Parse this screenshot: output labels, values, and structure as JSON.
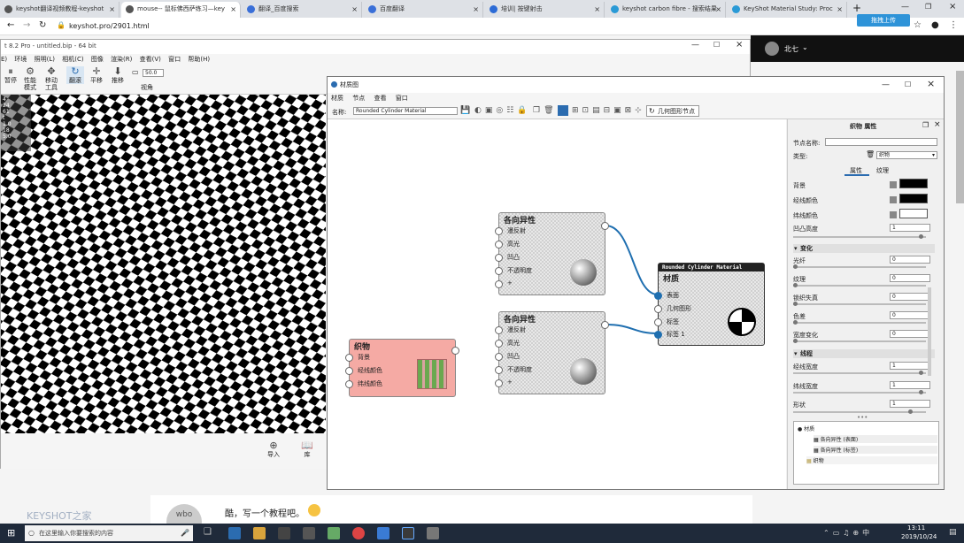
{
  "browser": {
    "tabs": [
      {
        "label": "keyshot翻译视频教程-keyshot"
      },
      {
        "label": "mouse-- 鼠标佛西萨练习—key"
      },
      {
        "label": "翻译_百度搜索"
      },
      {
        "label": "百度翻译"
      },
      {
        "label": "培训| 按键射击"
      },
      {
        "label": "keyshot carbon fibre - 搜索结果"
      },
      {
        "label": "KeyShot Material Study: Proc"
      }
    ],
    "new_tab": "+",
    "url": "keyshot.pro/2901.html",
    "upload_badge": "拖拽上传",
    "user_name": "北七"
  },
  "keyshot": {
    "title": "t 8.2 Pro - untitled.bip - 64 bit",
    "menu": [
      "E)",
      "环境",
      "照明(L)",
      "相机(C)",
      "图像",
      "渲染(R)",
      "查看(V)",
      "窗口",
      "帮助(H)"
    ],
    "toolbar": [
      {
        "label": "暂停",
        "icon": "pause-icon"
      },
      {
        "label": "性能\n模式",
        "icon": "performance-icon"
      },
      {
        "label": "移动\n工具",
        "icon": "move-tool-icon"
      },
      {
        "label": "翻滚",
        "icon": "tumble-icon"
      },
      {
        "label": "平移",
        "icon": "pan-icon"
      },
      {
        "label": "推移",
        "icon": "dolly-icon"
      }
    ],
    "fov_value": "50.0",
    "fov_label": "视角",
    "overlay_stats": [
      "4",
      "24",
      "61",
      "t",
      "1.0",
      "18",
      "5.0"
    ],
    "bottom": [
      {
        "label": "导入",
        "icon": "import-icon"
      },
      {
        "label": "库",
        "icon": "library-icon"
      }
    ]
  },
  "material_graph": {
    "title": "材质图",
    "menu": [
      "材质",
      "节点",
      "查看",
      "窗口"
    ],
    "name_label": "名称:",
    "name_value": "Rounded Cylinder Material",
    "geometry_btn": "几何图形节点",
    "nodes": {
      "aniso1": {
        "title": "各向异性",
        "ports": [
          "漫反射",
          "高光",
          "凹凸",
          "不透明度",
          "+"
        ]
      },
      "aniso2": {
        "title": "各向异性",
        "ports": [
          "漫反射",
          "高光",
          "凹凸",
          "不透明度",
          "+"
        ]
      },
      "weave": {
        "title": "织物",
        "ports": [
          "背景",
          "经线颜色",
          "纬线颜色"
        ]
      },
      "material": {
        "header": "Rounded Cylinder Material",
        "title": "材质",
        "ports": [
          "表面",
          "几何图形",
          "标签",
          "标签 1"
        ]
      }
    }
  },
  "panel": {
    "title": "织物 属性",
    "node_name_label": "节点名称:",
    "node_name_value": "",
    "type_label": "类型:",
    "type_value": "织物",
    "tabs": [
      "属性",
      "纹理"
    ],
    "props": [
      {
        "label": "背景",
        "color": "#000000"
      },
      {
        "label": "经线颜色",
        "color": "#000000"
      },
      {
        "label": "纬线颜色",
        "color": "#ffffff"
      }
    ],
    "bump_label": "凹凸高度",
    "bump_value": "1",
    "variation_header": "变化",
    "variation": [
      {
        "label": "光纤",
        "value": "0"
      },
      {
        "label": "纹理",
        "value": "0"
      },
      {
        "label": "锁织失真",
        "value": "0"
      },
      {
        "label": "色差",
        "value": "0"
      },
      {
        "label": "宽度变化",
        "value": "0"
      }
    ],
    "thread_header": "线程",
    "thread": [
      {
        "label": "经线宽度",
        "value": "1"
      },
      {
        "label": "纬线宽度",
        "value": "1"
      },
      {
        "label": "形状",
        "value": "1"
      }
    ],
    "tree": [
      {
        "label": "材质",
        "level": 0
      },
      {
        "label": "各向异性 (表面)",
        "level": 1
      },
      {
        "label": "各向异性 (标签)",
        "level": 1
      },
      {
        "label": "织物",
        "level": 1
      }
    ]
  },
  "comment": {
    "avatar_text": "wbo",
    "text": "酷，写一个教程吧。",
    "username": "KEYSHOT之家"
  },
  "taskbar": {
    "search_placeholder": "在这里输入你要搜索的内容",
    "time": "13:11",
    "date": "2019/10/24"
  }
}
